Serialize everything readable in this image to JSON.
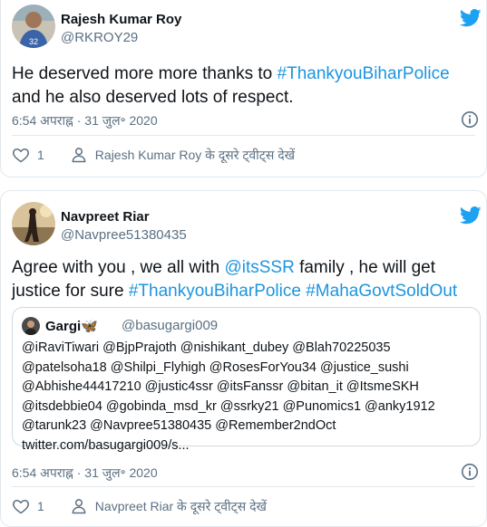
{
  "colors": {
    "link": "#1b95e0",
    "muted": "#5b7083",
    "text": "#0f1419",
    "border": "#e1e8ed"
  },
  "tweets": [
    {
      "name": "Rajesh Kumar Roy",
      "handle": "@RKROY29",
      "body": [
        {
          "text": "He deserved more more thanks to ",
          "type": "text"
        },
        {
          "text": "#ThankyouBiharPolice",
          "type": "hashtag"
        },
        {
          "text": " and he also deserved lots of respect.",
          "type": "text"
        }
      ],
      "timestamp": "6:54 अपराह्न · 31 जुल॰ 2020",
      "like_count": "1",
      "more_tweets": "Rajesh Kumar Roy के दूसरे ट्वीट्स देखें",
      "icons": {
        "brand": "twitter-bird-icon",
        "info": "info-icon",
        "like": "heart-icon",
        "profile": "person-icon"
      }
    },
    {
      "name": "Navpreet Riar",
      "handle": "@Navpree51380435",
      "body": [
        {
          "text": "Agree with you , we all with ",
          "type": "text"
        },
        {
          "text": "@itsSSR",
          "type": "mention"
        },
        {
          "text": " family , he will get justice for sure ",
          "type": "text"
        },
        {
          "text": "#ThankyouBiharPolice",
          "type": "hashtag"
        },
        {
          "text": " ",
          "type": "text"
        },
        {
          "text": "#MahaGovtSoldOut",
          "type": "hashtag"
        }
      ],
      "quote": {
        "name": "Gargi",
        "emoji": "🦋",
        "handle": "@basugargi009",
        "text": "@iRaviTiwari @BjpPrajoth @nishikant_dubey @Blah70225035 @patelsoha18 @Shilpi_Flyhigh @RosesForYou34 @justice_sushi @Abhishe44417210 @justic4ssr @itsFanssr @bitan_it @ItsmeSKH @itsdebbie04 @gobinda_msd_kr @ssrky21 @Punomics1 @anky1912 @tarunk23 @Navpree51380435 @Remember2ndOct twitter.com/basugargi009/s..."
      },
      "timestamp": "6:54 अपराह्न · 31 जुल॰ 2020",
      "like_count": "1",
      "more_tweets": "Navpreet Riar के दूसरे ट्वीट्स देखें",
      "icons": {
        "brand": "twitter-bird-icon",
        "info": "info-icon",
        "like": "heart-icon",
        "profile": "person-icon"
      }
    }
  ]
}
